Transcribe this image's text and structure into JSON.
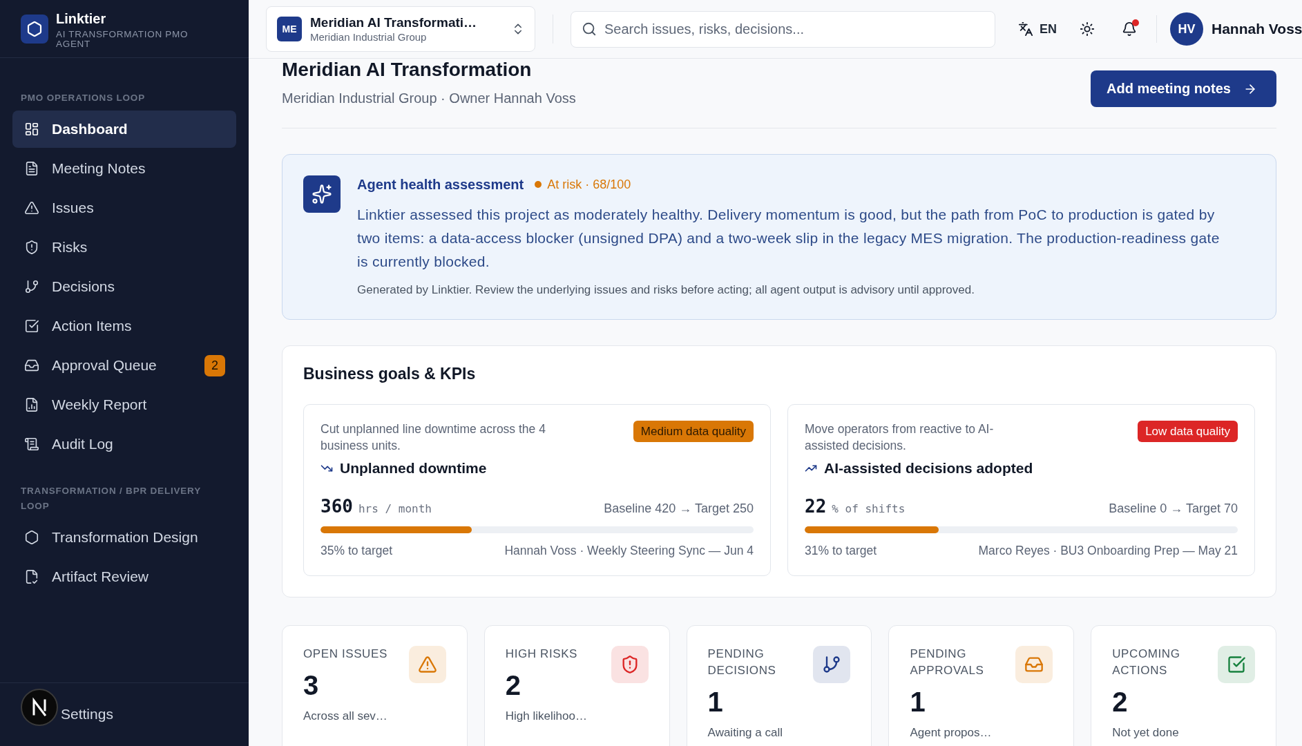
{
  "sidebar": {
    "brand": {
      "name": "Linktier",
      "tagline": "AI TRANSFORMATION PMO AGENT"
    },
    "sections": [
      {
        "title": "PMO OPERATIONS LOOP",
        "items": [
          {
            "label": "Dashboard",
            "selected": true
          },
          {
            "label": "Meeting Notes",
            "selected": false
          },
          {
            "label": "Issues",
            "selected": false
          },
          {
            "label": "Risks",
            "selected": false
          },
          {
            "label": "Decisions",
            "selected": false
          },
          {
            "label": "Action Items",
            "selected": false
          },
          {
            "label": "Approval Queue",
            "selected": false,
            "badge": "2"
          },
          {
            "label": "Weekly Report",
            "selected": false
          },
          {
            "label": "Audit Log",
            "selected": false
          }
        ]
      },
      {
        "title": "TRANSFORMATION / BPR DELIVERY LOOP",
        "items": [
          {
            "label": "Transformation Design",
            "selected": false
          },
          {
            "label": "Artifact Review",
            "selected": false
          }
        ]
      }
    ],
    "footer": {
      "label": "Settings"
    }
  },
  "header": {
    "project": {
      "initials": "ME",
      "name": "Meridian AI Transformati…",
      "org": "Meridian Industrial Group"
    },
    "search": {
      "placeholder": "Search issues, risks, decisions..."
    },
    "language": "EN",
    "notifications_unread": true,
    "user": {
      "initials": "HV",
      "name": "Hannah Voss"
    }
  },
  "page": {
    "title": "Meridian AI Transformation",
    "subtitle": "Meridian Industrial Group · Owner Hannah Voss",
    "action": "Add meeting notes"
  },
  "health": {
    "title": "Agent health assessment",
    "status": "At risk · 68/100",
    "summary": "Linktier assessed this project as moderately healthy. Delivery momentum is good, but the path from PoC to production is gated by two items: a data-access blocker (unsigned DPA) and a two-week slip in the legacy MES migration. The production-readiness gate is currently blocked.",
    "note": "Generated by Linktier. Review the underlying issues and risks before acting; all agent output is advisory until approved."
  },
  "kpis": {
    "title": "Business goals & KPIs",
    "goals": [
      {
        "description": "Cut unplanned line downtime across the 4 business units.",
        "quality_label": "Medium data quality",
        "color": "#d97706",
        "rising": false,
        "name": "Unplanned downtime",
        "value": "360",
        "unit": "hrs / month",
        "range": "Baseline 420 → Target 250",
        "level": 0.35,
        "progress": "35% to target",
        "source": "Hannah Voss · Weekly Steering Sync — Jun 4"
      },
      {
        "description": "Move operators from reactive to AI-assisted decisions.",
        "quality_label": "Low data quality",
        "color": "#dc2626",
        "rising": true,
        "name": "AI-assisted decisions adopted",
        "value": "22",
        "unit": "% of shifts",
        "range": "Baseline 0 → Target 70",
        "level": 0.31,
        "progress": "31% to target",
        "source": "Marco Reyes · BU3 Onboarding Prep — May 21"
      }
    ]
  },
  "stats": [
    {
      "label": "OPEN ISSUES",
      "value": "3",
      "note": "Across all sev…",
      "color": "#d97706"
    },
    {
      "label": "HIGH RISKS",
      "value": "2",
      "note": "High likelihoo…",
      "color": "#dc2626"
    },
    {
      "label": "PENDING DECISIONS",
      "value": "1",
      "note": "Awaiting a call",
      "color": "#1e3a8a"
    },
    {
      "label": "PENDING APPROVALS",
      "value": "1",
      "note": "Agent propos…",
      "color": "#d97706"
    },
    {
      "label": "UPCOMING ACTIONS",
      "value": "2",
      "note": "Not yet done",
      "color": "#15803d"
    }
  ]
}
